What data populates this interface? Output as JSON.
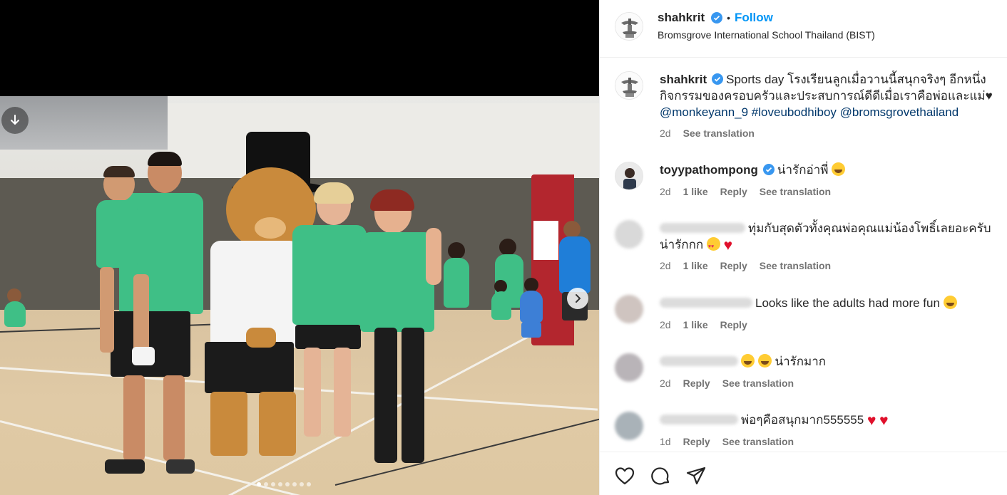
{
  "post": {
    "author": "shahkrit",
    "follow_label": "Follow",
    "separator": "•",
    "location": "Bromsgrove International School Thailand (BIST)"
  },
  "caption": {
    "author": "shahkrit",
    "text": "Sports day โรงเรียนลูกเมื่อวานนี้สนุกจริงๆ อีกหนึ่งกิจกรรมของครอบครัวและประสบการณ์ดีดีเมื่อเราคือพ่อและแม่♥",
    "tags": [
      "@monkeyann_9",
      "#loveubodhiboy",
      "@bromsgrovethailand"
    ],
    "age": "2d",
    "translate": "See translation"
  },
  "comments": [
    {
      "author": "toyypathompong",
      "verified": true,
      "text": "น่ารักอ่าพี่",
      "age": "2d",
      "likes": "1 like",
      "reply": "Reply",
      "translate": "See translation"
    },
    {
      "author": "",
      "text": "ทุ่มกับสุดตัวทั้งคุณพ่อคุณแม่น้องโพธิ์เลยอะครับ น่ารักกก",
      "age": "2d",
      "likes": "1 like",
      "reply": "Reply",
      "translate": "See translation"
    },
    {
      "author": "",
      "text": "Looks like the adults had more fun",
      "age": "2d",
      "likes": "1 like",
      "reply": "Reply"
    },
    {
      "author": "",
      "text": "น่ารักมาก",
      "age": "2d",
      "reply": "Reply",
      "translate": "See translation"
    },
    {
      "author": "",
      "text": "พ่อๆคือสนุกมาก555555",
      "age": "1d",
      "reply": "Reply",
      "translate": "See translation"
    }
  ],
  "carousel": {
    "slide_count": 8,
    "active_index": 0
  },
  "colors": {
    "accent": "#0095f6",
    "verified": "#3897f0",
    "tag": "#00376b",
    "muted": "#737373",
    "heart": "#e0102b"
  },
  "icons": [
    "verified-badge-icon",
    "download-icon",
    "chevron-right-icon",
    "heart-icon",
    "comment-icon",
    "share-icon"
  ]
}
